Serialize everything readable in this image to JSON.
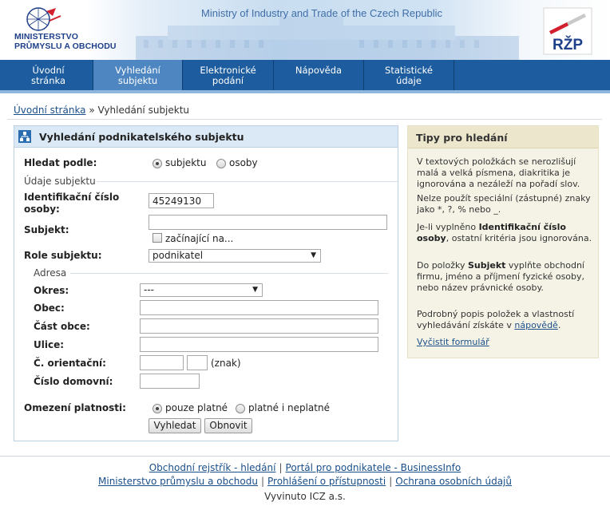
{
  "header": {
    "ministry_logo_line1": "MINISTERSTVO",
    "ministry_logo_line2": "PRŮMYSLU A OBCHODU",
    "ministry_title": "Ministry of Industry and Trade of the Czech Republic",
    "rzp_logo": "RŽP"
  },
  "nav": {
    "items": [
      {
        "line1": "Úvodní",
        "line2": "stránka"
      },
      {
        "line1": "Vyhledání",
        "line2": "subjektu"
      },
      {
        "line1": "Elektronické",
        "line2": "podání"
      },
      {
        "line1": "Nápověda",
        "line2": ""
      },
      {
        "line1": "Statistické",
        "line2": "údaje"
      }
    ]
  },
  "breadcrumb": {
    "home": "Úvodní stránka",
    "separator": "»",
    "current": "Vyhledání subjektu"
  },
  "search": {
    "title": "Vyhledání podnikatelského subjektu",
    "search_by_label": "Hledat podle:",
    "search_by_options": [
      "subjektu",
      "osoby"
    ],
    "search_by_selected": "subjektu",
    "subject_section": "Údaje subjektu",
    "ico_label_line1": "Identifikační číslo",
    "ico_label_line2": "osoby:",
    "ico_value": "45249130",
    "subject_label": "Subjekt:",
    "subject_value": "",
    "starts_with_label": "začínající na...",
    "role_label": "Role subjektu:",
    "role_value": "podnikatel",
    "address_section": "Adresa",
    "okres_label": "Okres:",
    "okres_value": "---",
    "obec_label": "Obec:",
    "cast_obce_label": "Část obce:",
    "ulice_label": "Ulice:",
    "orientacni_label": "Č. orientační:",
    "znak_label": "(znak)",
    "domovni_label": "Číslo domovní:",
    "validity_label": "Omezení platnosti:",
    "validity_options": [
      "pouze platné",
      "platné i neplatné"
    ],
    "validity_selected": "pouze platné",
    "search_button": "Vyhledat",
    "reset_button": "Obnovit"
  },
  "tips": {
    "title": "Tipy pro hledání",
    "p1": "V textových položkách se nerozlišují malá a velká písmena, diakritika je ignorována a nezáleží na pořadí slov.",
    "p2": "Nelze použít speciální (zástupné) znaky jako *, ?, % nebo _.",
    "p3_pre": "Je-li vyplněno ",
    "p3_bold": "Identifikační číslo osoby",
    "p3_post": ", ostatní kritéria jsou ignorována.",
    "p4_pre": "Do položky ",
    "p4_bold": "Subjekt",
    "p4_post": " vyplňte obchodní firmu, jméno a příjmení fyzické osoby, nebo název právnické osoby.",
    "p5_pre": "Podrobný popis položek a vlastností vyhledávání získáte v ",
    "p5_link": "nápovědě",
    "p5_post": ".",
    "clear_link": "Vyčistit formulář"
  },
  "footer": {
    "link1": "Obchodní rejstřík - hledání",
    "link2": "Portál pro podnikatele - BusinessInfo",
    "link3": "Ministerstvo průmyslu a obchodu",
    "link4": "Prohlášení o přístupnosti",
    "link5": "Ochrana osobních údajů",
    "separator": "|",
    "credit": "Vyvinuto ICZ a.s."
  },
  "colors": {
    "nav_bg": "#1d5d9f",
    "nav_active": "#4d86c0",
    "panel_head": "#dbe9f6",
    "tips_bg": "#f5f3e6",
    "link": "#1a4f8a"
  }
}
